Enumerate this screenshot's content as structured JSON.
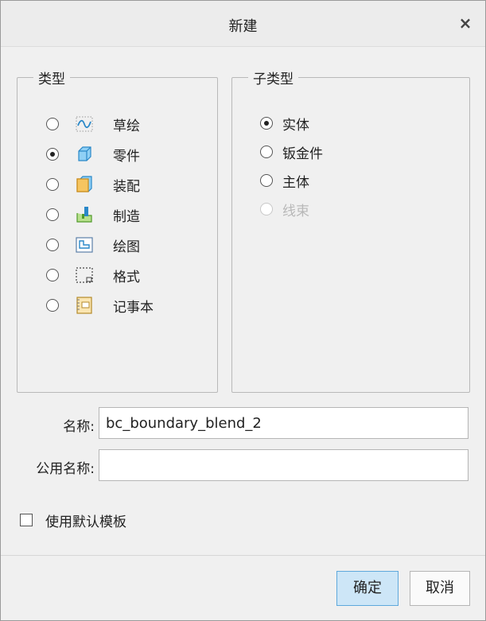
{
  "dialog": {
    "title": "新建",
    "close_symbol": "×"
  },
  "type_group": {
    "label": "类型",
    "items": [
      {
        "label": "草绘",
        "icon": "sketch-icon",
        "checked": false
      },
      {
        "label": "零件",
        "icon": "part-icon",
        "checked": true
      },
      {
        "label": "装配",
        "icon": "assembly-icon",
        "checked": false
      },
      {
        "label": "制造",
        "icon": "manufacturing-icon",
        "checked": false
      },
      {
        "label": "绘图",
        "icon": "drawing-icon",
        "checked": false
      },
      {
        "label": "格式",
        "icon": "format-icon",
        "checked": false
      },
      {
        "label": "记事本",
        "icon": "notebook-icon",
        "checked": false
      }
    ]
  },
  "subtype_group": {
    "label": "子类型",
    "items": [
      {
        "label": "实体",
        "checked": true,
        "disabled": false
      },
      {
        "label": "钣金件",
        "checked": false,
        "disabled": false
      },
      {
        "label": "主体",
        "checked": false,
        "disabled": false
      },
      {
        "label": "线束",
        "checked": false,
        "disabled": true
      }
    ]
  },
  "fields": {
    "name_label": "名称:",
    "name_value": "bc_boundary_blend_2",
    "common_name_label": "公用名称:",
    "common_name_value": ""
  },
  "use_default_template": {
    "label": "使用默认模板",
    "checked": false
  },
  "buttons": {
    "ok": "确定",
    "cancel": "取消"
  },
  "colors": {
    "accent_button_bg": "#cde6f7",
    "accent_button_border": "#5ea8dc"
  }
}
